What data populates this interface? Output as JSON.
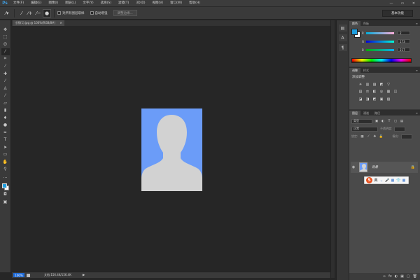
{
  "app": {
    "logo": "Ps"
  },
  "menu": [
    "文件(F)",
    "编辑(E)",
    "图像(I)",
    "图层(L)",
    "文字(Y)",
    "选择(S)",
    "滤镜(T)",
    "3D(D)",
    "视图(V)",
    "窗口(W)",
    "帮助(H)"
  ],
  "window_controls": {
    "minimize": "—",
    "restore": "▭",
    "close": "✕"
  },
  "options": {
    "sample_all_layers": "对所有图层取样",
    "auto_enhance": "自动增强",
    "refine_edge": "调整边缘...",
    "workspace": "基本功能"
  },
  "document": {
    "tab_title": "寸照(1).jpg @ 100%(RGB/8#)",
    "zoom": "100%",
    "doc_info": "文档:156.4K/156.4K",
    "status_arrow": "▶"
  },
  "color_panel": {
    "tabs": [
      "颜色",
      "色板"
    ],
    "sliders": [
      {
        "label": "R",
        "value": "2"
      },
      {
        "label": "G",
        "value": "173"
      },
      {
        "label": "B",
        "value": "217"
      }
    ],
    "fg_color": "#1f9fe0",
    "bg_color": "#ffffff"
  },
  "adjustments_panel": {
    "tabs": [
      "调整",
      "样式"
    ],
    "title": "添加调整",
    "row1": [
      "☀",
      "▥",
      "▨",
      "◩",
      "▽"
    ],
    "row2": [
      "▤",
      "⚖",
      "◧",
      "◎",
      "▦",
      "◫"
    ],
    "row3": [
      "◪",
      "◨",
      "◩",
      "▣",
      "▧"
    ]
  },
  "layers_panel": {
    "tabs": [
      "图层",
      "通道",
      "路径"
    ],
    "kind_filter": "类型",
    "blend_mode": "正常",
    "opacity_label": "不透明度:",
    "lock_label": "锁定:",
    "fill_label": "填充:",
    "layers": [
      {
        "name": "背景",
        "visible_icon": "◉",
        "lock_icon": "🔒"
      }
    ],
    "bottom_icons": [
      "∞",
      "fx",
      "◐",
      "▣",
      "▢",
      "🗑"
    ]
  },
  "ime": {
    "logo": "S",
    "mode": "英",
    "icons": [
      "·,",
      "🎤",
      "▦",
      "👕",
      "▦"
    ]
  }
}
